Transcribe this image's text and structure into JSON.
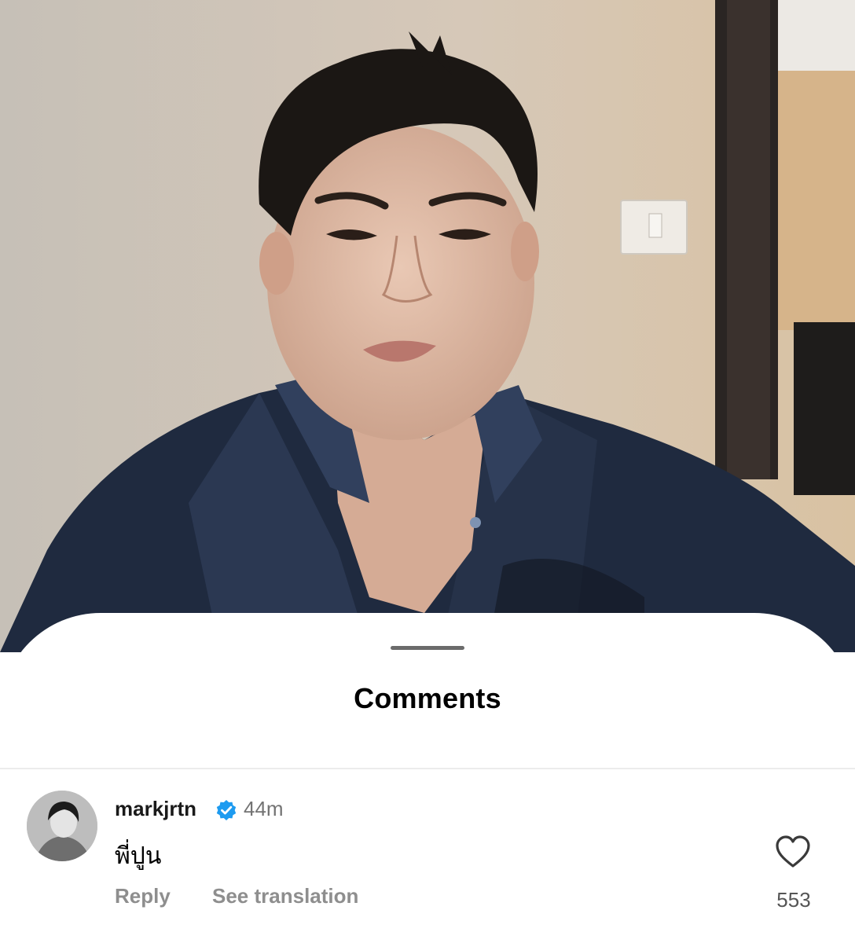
{
  "video": {
    "icon": "video-frame-person"
  },
  "sheet": {
    "title": "Comments"
  },
  "comment": {
    "username": "markjrtn",
    "verified_icon": "verified-badge-icon",
    "time": "44m",
    "text": "พี่ปูน",
    "reply_label": "Reply",
    "translate_label": "See translation",
    "like_icon": "heart-outline-icon",
    "like_count": "553"
  },
  "colors": {
    "verified": "#1d9bf0",
    "secondary_text": "#8e8e8e",
    "sheet_bg": "#ffffff"
  }
}
